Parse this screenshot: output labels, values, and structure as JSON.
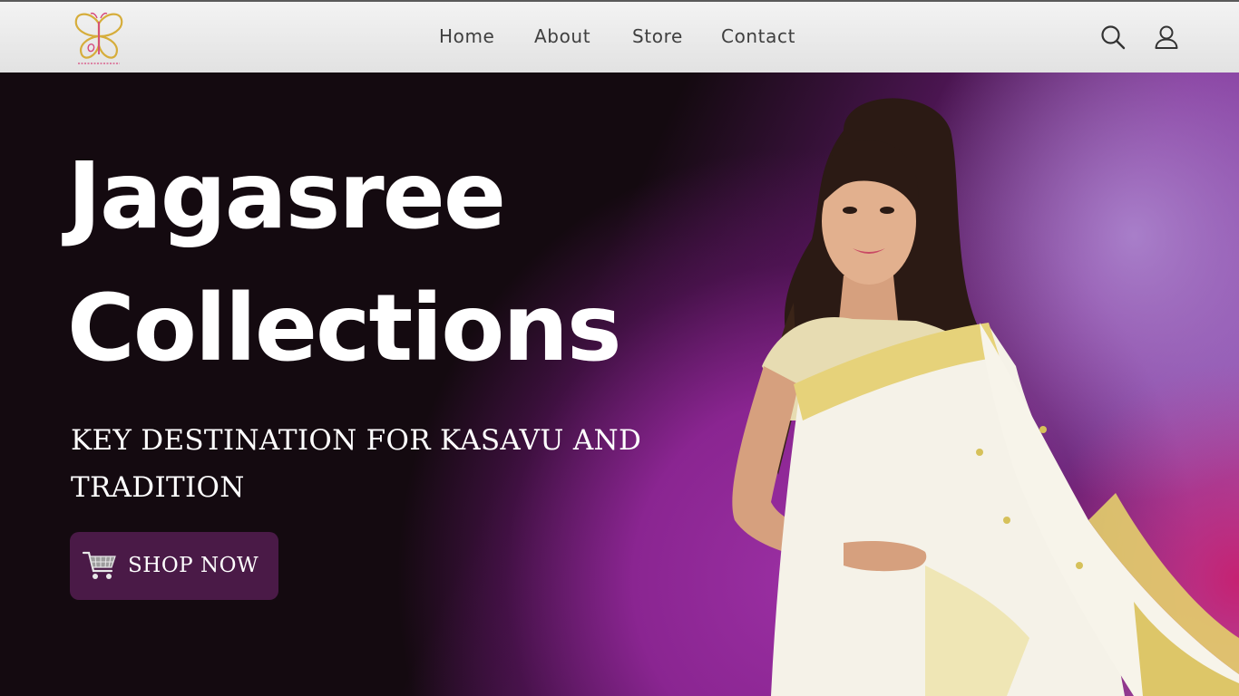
{
  "header": {
    "logo_icon": "butterfly-logo",
    "logo_colors": {
      "gold": "#d6ad3b",
      "pink": "#d6487c"
    },
    "nav": [
      {
        "label": "Home"
      },
      {
        "label": "About"
      },
      {
        "label": "Store"
      },
      {
        "label": "Contact"
      }
    ],
    "search_icon": "search-icon",
    "account_icon": "user-icon"
  },
  "hero": {
    "title_line1": "Jagasree",
    "title_line2": "Collections",
    "subtitle": "KEY DESTINATION FOR KASAVU AND TRADITION",
    "cta": {
      "label": "SHOP NOW",
      "icon": "shopping-cart-icon"
    },
    "image": "model-in-kasavu-saree",
    "colors": {
      "dark": "#140a10",
      "purple": "#9a2fa2",
      "magenta": "#c81e6e",
      "button": "#4a1a47"
    }
  }
}
